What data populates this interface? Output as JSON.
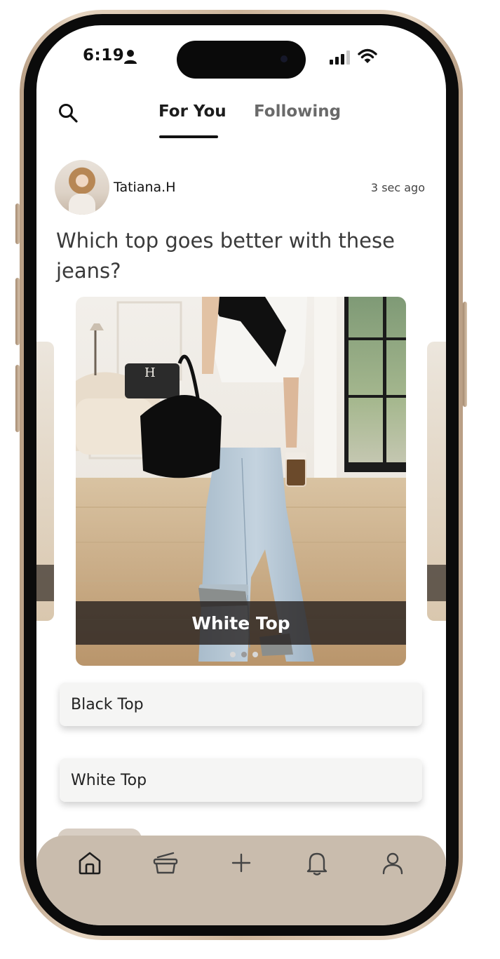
{
  "status_bar": {
    "time": "6:19"
  },
  "nav": {
    "tabs": [
      {
        "label": "For You",
        "active": true
      },
      {
        "label": "Following",
        "active": false
      }
    ]
  },
  "post": {
    "username": "Tatiana.H",
    "time_ago": "3 sec ago",
    "question": "Which top goes better with these jeans?",
    "carousel": {
      "current_caption": "White Top",
      "pages": 3,
      "active_page": 1
    },
    "options": [
      {
        "label": "Black Top"
      },
      {
        "label": "White Top"
      }
    ]
  },
  "bottom_nav": {
    "items": [
      "home-icon",
      "basket-icon",
      "plus-icon",
      "bell-icon",
      "profile-icon"
    ]
  },
  "colors": {
    "tab_bar": "#c9bcad",
    "caption_band": "#221e1c",
    "option_bg": "#f5f5f4"
  }
}
